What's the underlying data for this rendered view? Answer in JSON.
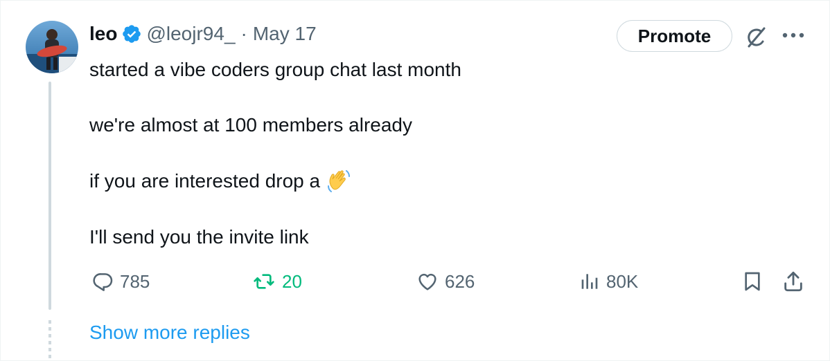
{
  "tweet": {
    "author_name": "leo",
    "handle": "@leojr94_",
    "separator": "·",
    "date": "May 17",
    "promote_label": "Promote",
    "lines": [
      "started a vibe coders group chat last month",
      "we're almost at 100 members already",
      "if you are interested drop a",
      "I'll send you the invite link"
    ],
    "emoji": "waving-hand-emoji"
  },
  "actions": {
    "replies": "785",
    "reposts": "20",
    "likes": "626",
    "views": "80K"
  },
  "thread": {
    "show_more_label": "Show more replies"
  },
  "colors": {
    "text": "#0f1419",
    "muted": "#536471",
    "link": "#1d9bf0",
    "repost_active": "#00ba7c",
    "verified": "#1d9bf0",
    "border": "#cfd9de"
  },
  "icons": [
    "verified-badge-icon",
    "grok-icon",
    "more-icon",
    "reply-icon",
    "repost-icon",
    "like-icon",
    "views-icon",
    "bookmark-icon",
    "share-icon"
  ]
}
